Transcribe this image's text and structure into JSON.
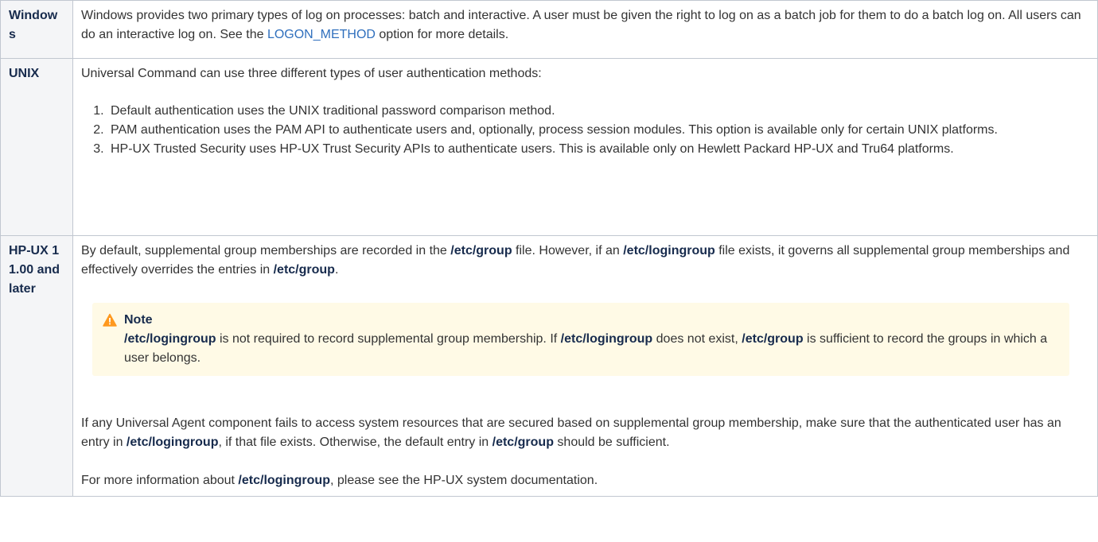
{
  "rows": {
    "windows": {
      "label": "Windows",
      "text_1": "Windows provides two primary types of log on processes: batch and interactive. A user must be given the right to log on as a batch job for them to do a batch log on. All users can do an interactive log on. See the ",
      "link": "LOGON_METHOD",
      "text_2": " option for more details."
    },
    "unix": {
      "label": "UNIX",
      "intro": "Universal Command can use three different types of user authentication methods:",
      "items": [
        "Default authentication uses the UNIX traditional password comparison method.",
        "PAM authentication uses the PAM API to authenticate users and, optionally, process session modules. This option is available only for certain UNIX platforms.",
        "HP-UX Trusted Security uses HP-UX Trust Security APIs to authenticate users. This is available only on Hewlett Packard HP-UX and Tru64 platforms."
      ]
    },
    "hpux": {
      "label": "HP-UX 11.00 and later",
      "p1": {
        "a": "By default, supplemental group memberships are recorded in the ",
        "b1": "/etc/group",
        "c": " file. However, if an ",
        "b2": "/etc/logingroup",
        "d": " file exists, it governs all supplemental group memberships and effectively overrides the entries in ",
        "b3": "/etc/group",
        "e": "."
      },
      "note": {
        "title": "Note",
        "b1": "/etc/logingroup",
        "a": " is not required to record supplemental group membership. If ",
        "b2": "/etc/logingroup",
        "c": " does not exist, ",
        "b3": "/etc/group",
        "d": " is sufficient to record the groups in which a user belongs."
      },
      "p2": {
        "a": "If any Universal Agent component fails to access system resources that are secured based on supplemental group membership, make sure that the authenticated user has an entry in ",
        "b1": "/etc/logingroup",
        "c": ", if that file exists. Otherwise, the default entry in ",
        "b2": "/etc/group",
        "d": " should be sufficient."
      },
      "p3": {
        "a": "For more information about ",
        "b1": "/etc/logingroup",
        "c": ", please see the HP-UX system documentation."
      }
    }
  },
  "colors": {
    "label_bg": "#f4f5f7",
    "border": "#c1c7d0",
    "link": "#2f6fbd",
    "note_bg": "#fffae6",
    "warning_icon": "#ff991f"
  },
  "icons": {
    "note": "warning-icon"
  }
}
